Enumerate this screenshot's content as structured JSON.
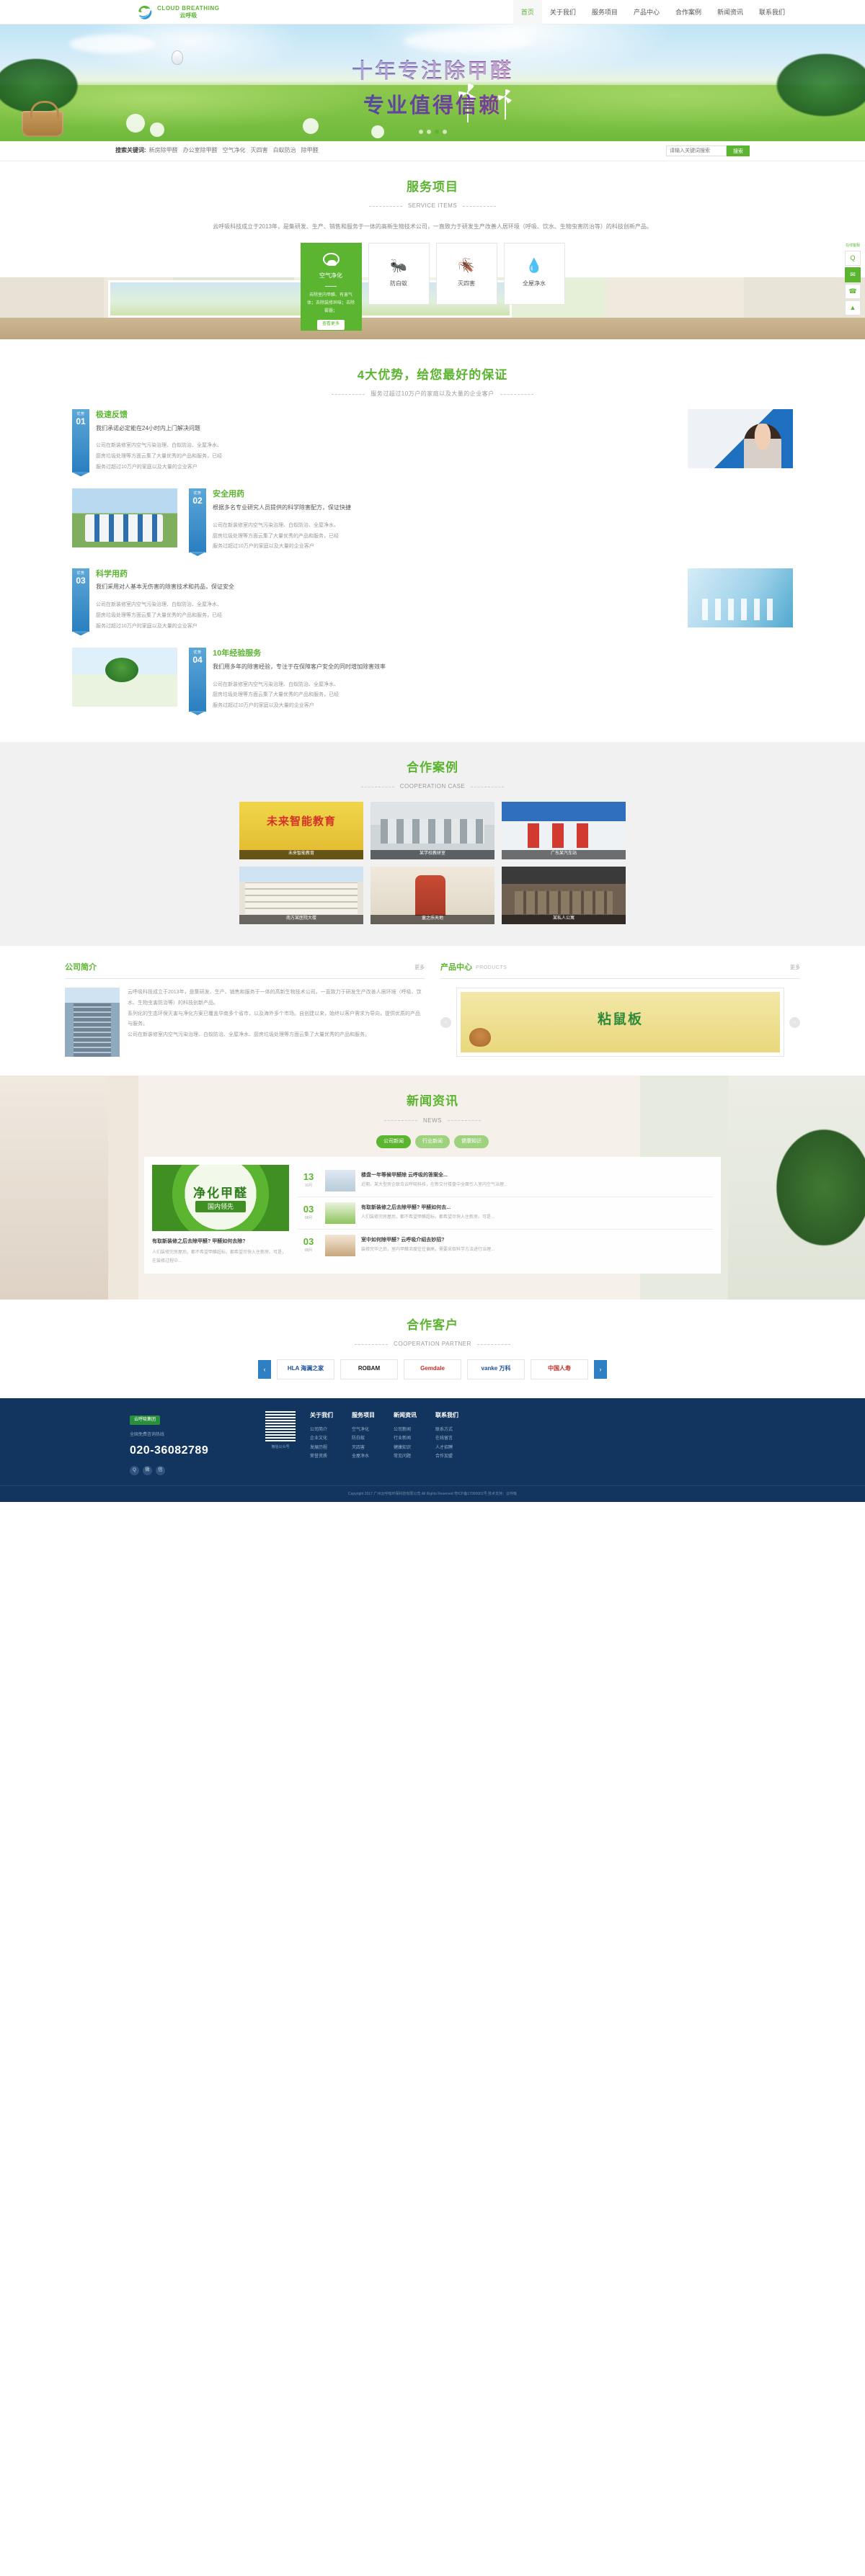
{
  "header": {
    "logo": {
      "en": "CLOUD BREATHING",
      "cn": "云呼吸",
      "icon": "cloud-leaf-logo"
    },
    "nav": [
      {
        "label": "首页",
        "active": true
      },
      {
        "label": "关于我们",
        "active": false
      },
      {
        "label": "服务项目",
        "active": false
      },
      {
        "label": "产品中心",
        "active": false
      },
      {
        "label": "合作案例",
        "active": false
      },
      {
        "label": "新闻资讯",
        "active": false
      },
      {
        "label": "联系我们",
        "active": false
      }
    ]
  },
  "banner": {
    "line1": "十年专注除甲醛",
    "line2": "专业值得信赖",
    "dots": 4,
    "active_dot": 2
  },
  "search": {
    "label": "搜索关键词:",
    "keywords": [
      "新房除甲醛",
      "办公室除甲醛",
      "空气净化",
      "灭四害",
      "白蚁防治",
      "除甲醛"
    ],
    "placeholder": "请输入关键词搜索",
    "button": "搜索"
  },
  "services": {
    "title": "服务项目",
    "subtitle": "SERVICE ITEMS",
    "desc": "云呼吸科技成立于2013年，是集研发、生产、销售和服务于一体的高新生物技术公司，一直致力于研发生产改善人居环境（呼吸、饮水、生物虫害防治等）的科技创新产品。",
    "cards": [
      {
        "name": "空气净化",
        "icon": "air-purify-icon",
        "featured": true,
        "desc": "去除室内甲醛、有害气体；去除装修异味；去除雾霾；",
        "button": "查看更多"
      },
      {
        "name": "防白蚁",
        "icon": "termite-icon",
        "featured": false
      },
      {
        "name": "灭四害",
        "icon": "pest-icon",
        "featured": false
      },
      {
        "name": "全屋净水",
        "icon": "water-drop-icon",
        "featured": false
      }
    ]
  },
  "floatbar": {
    "label": "在线客服",
    "items": [
      "qq-icon",
      "wechat-icon",
      "phone-icon",
      "top-icon"
    ]
  },
  "advantages": {
    "title": "4大优势，给您最好的保证",
    "subtitle": "服务过超过10万户的家庭以及大量的企业客户",
    "shared_paragraph": "公司在新装修室内空气污染治理、白蚁防治、全屋净水、厨房垃圾处理等方面云集了大量优秀的产品和服务，已经服务过超过10万户的家庭以及大量的企业客户",
    "items": [
      {
        "ribbon_label": "优势",
        "number": "01",
        "title": "极速反馈",
        "sub": "我们承诺必定能在24小时内上门解决问题",
        "image": "customer-service-photo"
      },
      {
        "ribbon_label": "优势",
        "number": "02",
        "title": "安全用药",
        "sub": "根据多名专业研究人员提供的科学除害配方，保证快捷",
        "image": "field-team-photo"
      },
      {
        "ribbon_label": "优势",
        "number": "03",
        "title": "科学用药",
        "sub": "我们采用对人基本无伤害的除害技术和药品，保证安全",
        "image": "laboratory-photo"
      },
      {
        "ribbon_label": "优势",
        "number": "04",
        "title": "10年经验服务",
        "sub": "我们用多年的除害经验，专注于在保障客户安全的同时增加除害效率",
        "image": "green-hands-photo"
      }
    ]
  },
  "cooperation": {
    "title": "合作案例",
    "subtitle": "COOPERATION CASE",
    "cases": [
      {
        "caption": "未来智能教育",
        "image": "future-education-banner"
      },
      {
        "caption": "某学校教研室",
        "image": "school-lab-room"
      },
      {
        "caption": "广东某汽车站",
        "image": "bus-station-staff"
      },
      {
        "caption": "南方某医院大楼",
        "image": "hospital-building"
      },
      {
        "caption": "童之乐天地",
        "image": "kids-play-area"
      },
      {
        "caption": "某私人公寓",
        "image": "private-apartment"
      }
    ]
  },
  "company": {
    "title": "公司简介",
    "more": "更多",
    "paragraphs": [
      "云呼吸科技成立于2013年，是集研发、生产、销售和服务于一体的高新生物技术公司，一直致力于研发生产改善人居环境（呼吸、饮水、生物虫害防治等）的科技创新产品。",
      "系列化的生态环保灭害与净化方案已覆盖华南多个省市，以及海外多个市场。自创建以来，始终以客户需求为导向，提供优质的产品与服务。",
      "公司在新装修室内空气污染治理、白蚁防治、全屋净水、厨房垃圾处理等方面云集了大量优秀的产品和服务。"
    ],
    "image": "office-building-photo"
  },
  "products": {
    "title": "产品中心",
    "title_en": "PRODUCTS",
    "more": "更多",
    "item": {
      "name": "粘鼠板",
      "image": "sticky-mouse-board-package"
    },
    "prev_icon": "chevron-left-icon",
    "next_icon": "chevron-right-icon"
  },
  "news": {
    "title": "新闻资讯",
    "subtitle": "NEWS",
    "tabs": [
      {
        "label": "公司新闻",
        "active": true
      },
      {
        "label": "行业新闻",
        "active": false
      },
      {
        "label": "健康知识",
        "active": false
      }
    ],
    "feature": {
      "banner_title": "净化甲醛",
      "banner_badge": "国内领先",
      "caption": "有取新装修之后去除甲醛? 甲醛如何去除?",
      "text": "人们装修完房屋后，都不希望甲醛超标，都希望尽快入住新房。可是，在装修过程中..."
    },
    "list": [
      {
        "day": "13",
        "month": "10月",
        "title": "楼盘一年等候甲醛除 云呼吸的答案全...",
        "text": "近期，某大型房企联合云呼吸科技，在新交付楼盘中全面引入室内空气治理..."
      },
      {
        "day": "03",
        "month": "08月",
        "title": "有取新装修之后去除甲醛? 甲醛如何去...",
        "text": "人们装修完房屋后，都不希望甲醛超标，都希望尽快入住新房。可是..."
      },
      {
        "day": "03",
        "month": "08月",
        "title": "室中如何除甲醛? 云呼吸介绍去妙招?",
        "text": "装修完毕之后，室内甲醛浓度往往偏高，需要采取科学方法进行治理..."
      }
    ]
  },
  "partners": {
    "title": "合作客户",
    "subtitle": "COOPERATION PARTNER",
    "prev_icon": "chevron-left-icon",
    "next_icon": "chevron-right-icon",
    "logos": [
      {
        "name": "HLA 海澜之家",
        "style": "blue"
      },
      {
        "name": "ROBAM",
        "style": "dark"
      },
      {
        "name": "Gemdale",
        "style": "red"
      },
      {
        "name": "vanke 万科",
        "style": "blue"
      },
      {
        "name": "中国人寿",
        "style": "red"
      }
    ]
  },
  "footer": {
    "logo_label": "云呼吸集团",
    "hotline_label": "全国免费咨询热线",
    "hotline": "020-36082789",
    "social": [
      "qq-icon",
      "weibo-icon",
      "wechat-icon"
    ],
    "qr_caption": "微信公众号",
    "columns": [
      {
        "title": "关于我们",
        "links": [
          "公司简介",
          "企业文化",
          "发展历程",
          "荣誉资质"
        ]
      },
      {
        "title": "服务项目",
        "links": [
          "空气净化",
          "防白蚁",
          "灭四害",
          "全屋净水"
        ]
      },
      {
        "title": "新闻资讯",
        "links": [
          "公司新闻",
          "行业新闻",
          "健康知识",
          "常见问题"
        ]
      },
      {
        "title": "联系我们",
        "links": [
          "联系方式",
          "在线留言",
          "人才招聘",
          "合作加盟"
        ]
      }
    ],
    "copyright": "Copyright 2017  广州云呼吸环保科技有限公司 All Rights Reserved 粤ICP备17000001号 技术支持：云呼吸"
  }
}
